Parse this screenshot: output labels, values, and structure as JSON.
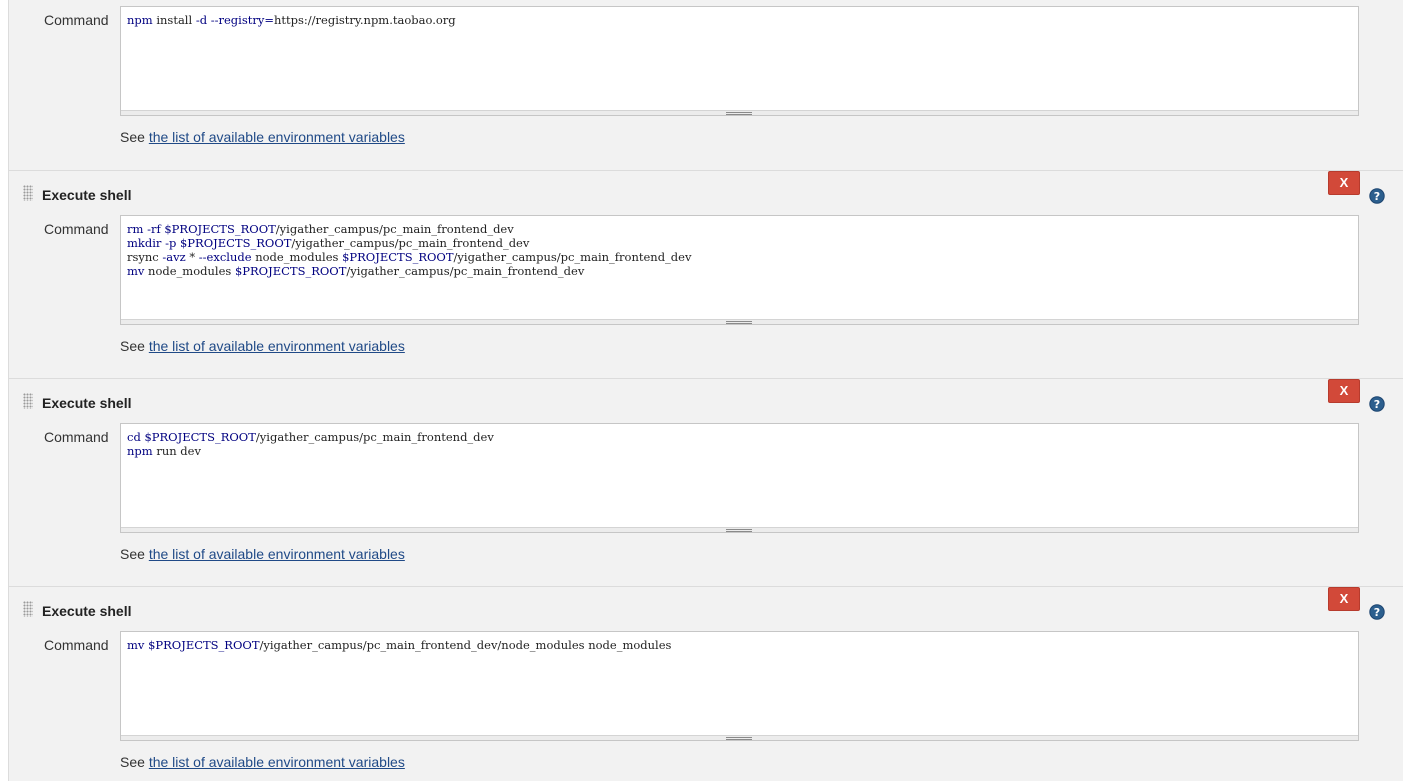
{
  "steps": [
    {
      "title": "",
      "command_label": "Command",
      "command_lines": [
        "npm install -d --registry=https://registry.npm.taobao.org"
      ],
      "env_prefix": "See",
      "env_link": "the list of available environment variables"
    },
    {
      "title": "Execute shell",
      "delete_label": "X",
      "command_label": "Command",
      "command_lines": [
        "rm -rf $PROJECTS_ROOT/yigather_campus/pc_main_frontend_dev",
        "mkdir -p $PROJECTS_ROOT/yigather_campus/pc_main_frontend_dev",
        "rsync -avz * --exclude node_modules $PROJECTS_ROOT/yigather_campus/pc_main_frontend_dev",
        "mv node_modules $PROJECTS_ROOT/yigather_campus/pc_main_frontend_dev"
      ],
      "env_prefix": "See",
      "env_link": "the list of available environment variables"
    },
    {
      "title": "Execute shell",
      "delete_label": "X",
      "command_label": "Command",
      "command_lines": [
        "cd $PROJECTS_ROOT/yigather_campus/pc_main_frontend_dev",
        "npm run dev"
      ],
      "env_prefix": "See",
      "env_link": "the list of available environment variables"
    },
    {
      "title": "Execute shell",
      "delete_label": "X",
      "command_label": "Command",
      "command_lines": [
        "mv $PROJECTS_ROOT/yigather_campus/pc_main_frontend_dev/node_modules node_modules"
      ],
      "env_prefix": "See",
      "env_link": "the list of available environment variables"
    }
  ],
  "colors": {
    "section_bg": "#f2f2f2",
    "delete_button": "#d24939",
    "help_icon": "#2c5f8e",
    "link": "#204a87"
  },
  "icons": {
    "help": "question-circle-icon",
    "handle": "drag-handle-icon"
  }
}
